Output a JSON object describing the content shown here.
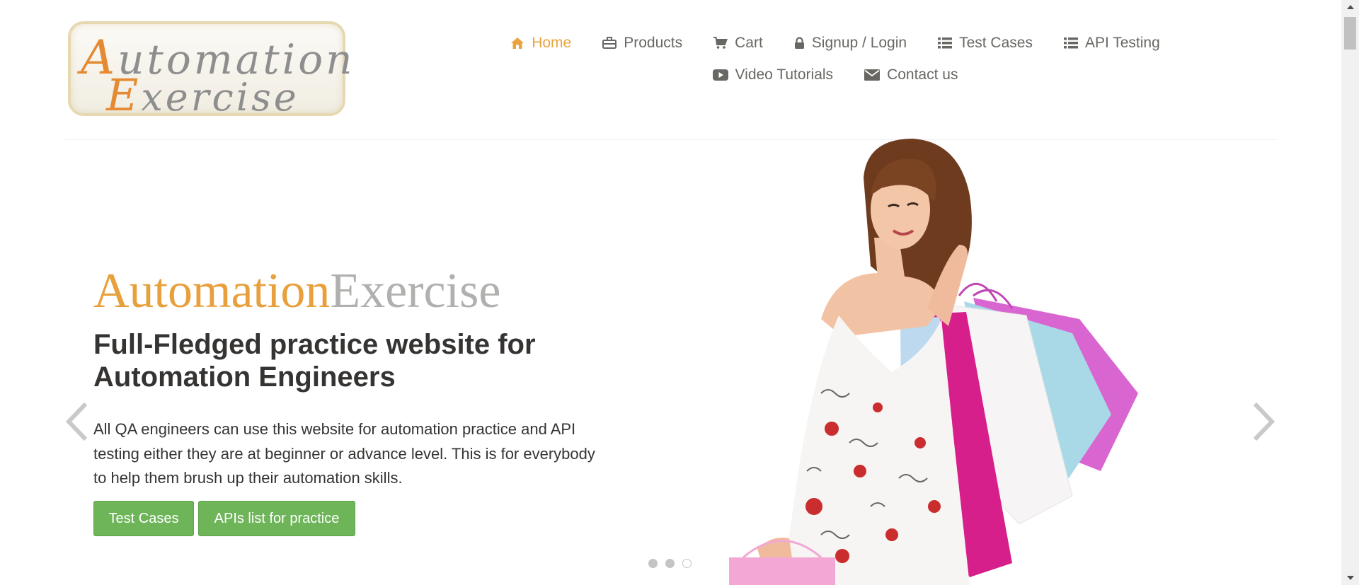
{
  "logo": {
    "line1_cap": "A",
    "line1_rest": "utomation",
    "line2_cap": "E",
    "line2_rest": "xercise"
  },
  "nav": {
    "row1": [
      {
        "label": "Home",
        "icon": "home-icon",
        "active": true
      },
      {
        "label": "Products",
        "icon": "briefcase-icon"
      },
      {
        "label": "Cart",
        "icon": "cart-icon"
      },
      {
        "label": "Signup / Login",
        "icon": "lock-icon"
      },
      {
        "label": "Test Cases",
        "icon": "list-icon"
      },
      {
        "label": "API Testing",
        "icon": "list-icon"
      }
    ],
    "row2": [
      {
        "label": "Video Tutorials",
        "icon": "youtube-play-icon"
      },
      {
        "label": "Contact us",
        "icon": "envelope-icon"
      }
    ]
  },
  "hero": {
    "title_part1": "Automation",
    "title_part2": "Exercise",
    "subtitle": "Full-Fledged practice website for Automation Engineers",
    "description": "All QA engineers can use this website for automation practice and API testing either they are at beginner or advance level. This is for everybody to help them brush up their automation skills.",
    "button_test_cases": "Test Cases",
    "button_apis": "APIs list for practice",
    "carousel": {
      "slides": 3,
      "active_index": 2
    }
  },
  "colors": {
    "accent": "#e8a33d",
    "nav_text": "#696763",
    "button_green": "#6eb559",
    "title_grey": "#b1b0ae",
    "heading": "#363432"
  }
}
